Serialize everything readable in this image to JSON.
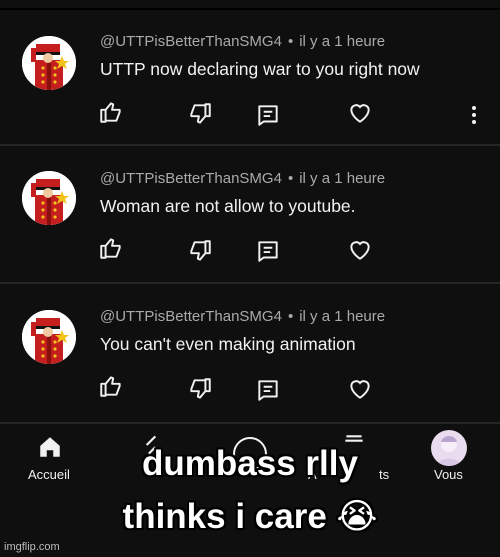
{
  "comments": [
    {
      "author": "@UTTPisBetterThanSMG4",
      "time": "il y a 1 heure",
      "text": "UTTP now declaring war to you right now"
    },
    {
      "author": "@UTTPisBetterThanSMG4",
      "time": "il y a 1 heure",
      "text": "Woman are not allow to youtube."
    },
    {
      "author": "@UTTPisBetterThanSMG4",
      "time": "il y a 1 heure",
      "text": "You can't even making animation"
    }
  ],
  "separator": "•",
  "nav": {
    "home_label": "Accueil",
    "you_label": "Vous",
    "abos_fragment": "A",
    "abos_suffix": "ts"
  },
  "caption": {
    "line1": "dumbass rlly",
    "line2": "thinks i care 😭"
  },
  "watermark": "imgflip.com",
  "icons": {
    "like": "thumbs-up-icon",
    "dislike": "thumbs-down-icon",
    "reply": "reply-icon",
    "heart": "heart-icon",
    "more": "more-vertical-icon"
  },
  "colors": {
    "background": "#0f0f0f",
    "text": "#f1f1f1",
    "meta": "#aaaaaa",
    "avatar_red": "#c41e1e",
    "avatar_gold": "#f3c21b"
  }
}
